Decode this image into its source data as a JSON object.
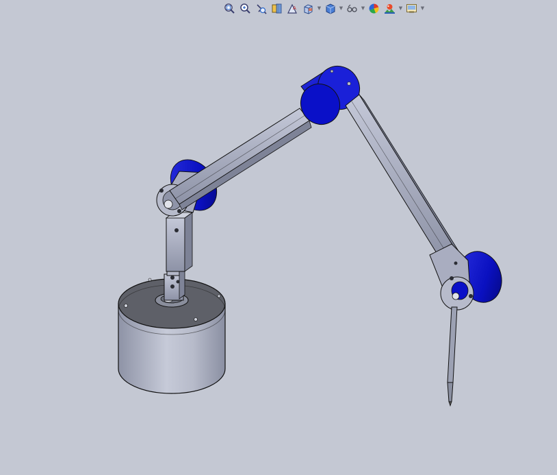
{
  "toolbar": {
    "items": [
      {
        "icon": "zoom-to-fit-icon",
        "dropdown": false
      },
      {
        "icon": "zoom-to-area-icon",
        "dropdown": false
      },
      {
        "icon": "previous-view-icon",
        "dropdown": false
      },
      {
        "icon": "section-view-icon",
        "dropdown": false
      },
      {
        "icon": "dynamic-annotation-icon",
        "dropdown": false
      },
      {
        "icon": "view-orientation-icon",
        "dropdown": true
      },
      {
        "icon": "display-style-icon",
        "dropdown": true
      },
      {
        "icon": "hide-show-items-icon",
        "dropdown": true
      },
      {
        "icon": "edit-appearance-icon",
        "dropdown": false
      },
      {
        "icon": "apply-scene-icon",
        "dropdown": true
      },
      {
        "icon": "view-settings-icon",
        "dropdown": true
      }
    ]
  },
  "colors": {
    "background": "#c4c8d3",
    "motor_blue": "#0a10c8",
    "link_steel": "#a6abbf",
    "base_metal": "#adb2c2",
    "base_top": "#5c5e66"
  }
}
